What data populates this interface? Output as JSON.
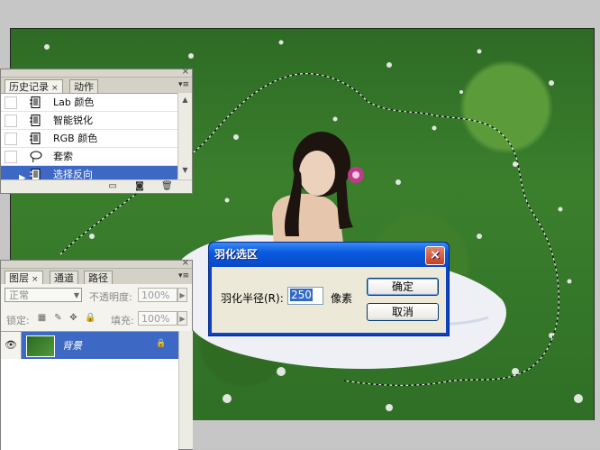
{
  "history_panel": {
    "tabs": [
      {
        "label": "历史记录",
        "close": "×"
      },
      {
        "label": "动作"
      }
    ],
    "menu_icon": "palette-menu-icon",
    "close_icon": "×",
    "items": [
      {
        "label": "Lab 颜色",
        "icon": "document-icon"
      },
      {
        "label": "智能锐化",
        "icon": "document-icon"
      },
      {
        "label": "RGB 颜色",
        "icon": "document-icon"
      },
      {
        "label": "套索",
        "icon": "lasso-icon"
      },
      {
        "label": "选择反向",
        "icon": "document-icon",
        "selected": true
      }
    ],
    "footer_icons": [
      "new-document-icon",
      "snapshot-icon",
      "trash-icon"
    ]
  },
  "layers_panel": {
    "tabs": [
      {
        "label": "图层",
        "close": "×"
      },
      {
        "label": "通道"
      },
      {
        "label": "路径"
      }
    ],
    "blend_mode": "正常",
    "opacity_label": "不透明度:",
    "opacity_value": "100%",
    "lock_label": "锁定:",
    "fill_label": "填充:",
    "fill_value": "100%",
    "layers": [
      {
        "name": "背景",
        "visible": true,
        "locked": true
      }
    ]
  },
  "feather_dialog": {
    "title": "羽化选区",
    "radius_label": "羽化半径(R):",
    "radius_value": "250",
    "unit": "像素",
    "ok_label": "确定",
    "cancel_label": "取消"
  },
  "colors": {
    "selection": "#3d68c4",
    "xp_title": "#0a5ae0",
    "grass": "#2f6f26"
  }
}
